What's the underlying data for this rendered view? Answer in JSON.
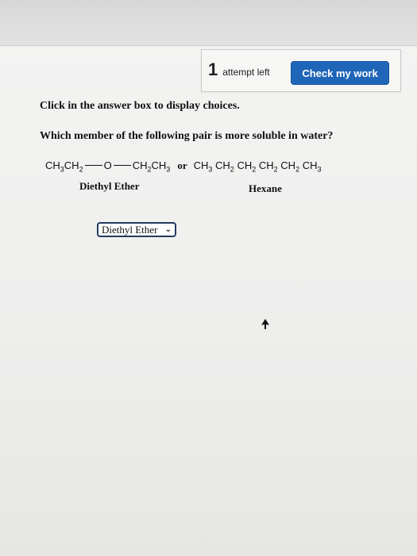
{
  "header": {
    "attempts_count": "1",
    "attempts_label": "attempt left",
    "check_button_label": "Check my work"
  },
  "question": {
    "instruction": "Click in the answer box to display choices.",
    "prompt": "Which member of the following pair is more soluble in water?",
    "compound_a": {
      "formula_left": [
        "CH",
        "3",
        "CH",
        "2"
      ],
      "oxygen": "O",
      "formula_right": [
        "CH",
        "2",
        "CH",
        "3"
      ],
      "name": "Diethyl Ether"
    },
    "connector": "or",
    "compound_b": {
      "formula": [
        "CH",
        "3",
        "CH",
        "2",
        "CH",
        "2",
        "CH",
        "2",
        "CH",
        "2",
        "CH",
        "3"
      ],
      "name": "Hexane"
    }
  },
  "answer": {
    "selected_value": "Diethyl Ether"
  },
  "icons": {
    "dropdown": "chevron-down-icon",
    "cursor": "mouse-pointer-icon"
  }
}
